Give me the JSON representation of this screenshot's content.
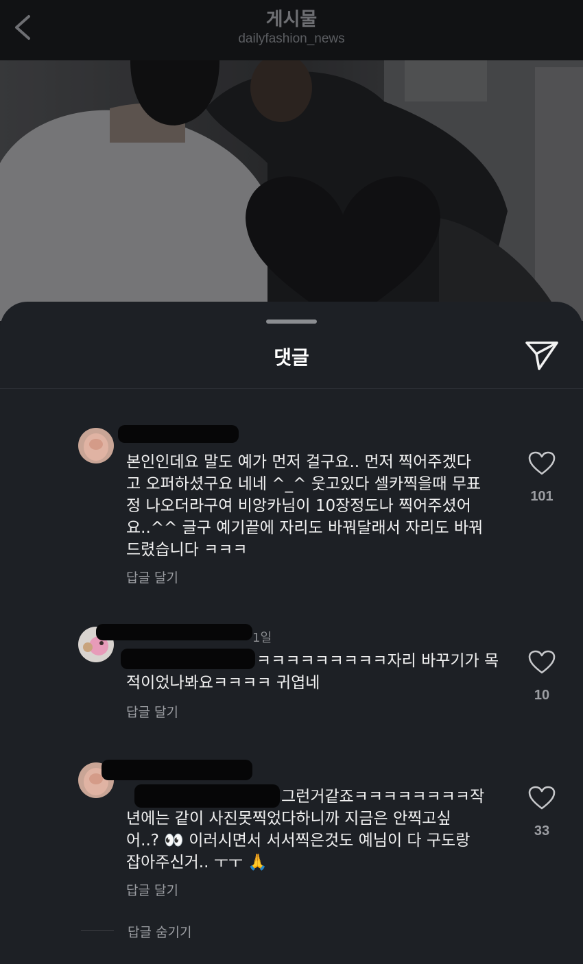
{
  "header": {
    "title": "게시물",
    "subtitle": "dailyfashion_news"
  },
  "sheet": {
    "title": "댓글"
  },
  "comments": [
    {
      "username": "",
      "time": "",
      "mention": "",
      "text": "본인인데요 말도 예가 먼저 걸구요.. 먼저 찍어주겠다\n고 오퍼하셨구요 네네 ^_^ 웃고있다 셀카찍을때 무표\n정 나오더라구여 비앙카님이 10장정도나 찍어주셨어\n요..^^ 글구 예기끝에 자리도 바꿔달래서 자리도 바꿔\n드렸습니다 ㅋㅋㅋ",
      "reply_label": "답글 달기",
      "likes": "101"
    },
    {
      "username": "",
      "time": "1일",
      "mention": "",
      "text": "ㅋㅋㅋㅋㅋㅋㅋㅋㅋ자리 바꾸기가 목\n적이었나봐요ㅋㅋㅋㅋ 귀엽네",
      "reply_label": "답글 달기",
      "likes": "10"
    },
    {
      "username": "",
      "time": "",
      "mention": "",
      "text": "그런거같죠ㅋㅋㅋㅋㅋㅋㅋㅋ작\n년에는 같이 사진못찍었다하니까 지금은 안찍고싶\n어..? 👀 이러시면서 서서찍은것도 예님이 다 구도랑\n잡아주신거.. ㅜㅜ 🙏",
      "reply_label": "답글 달기",
      "likes": "33"
    }
  ],
  "hide_replies_label": "답글 숨기기",
  "icons": {
    "back": "chevron-left-icon",
    "send": "send-icon",
    "like": "heart-icon"
  },
  "colors": {
    "background": "#1d2025",
    "topbar": "#111214",
    "mention": "#5b8ee6",
    "secondary_text": "#9c9ea3"
  }
}
